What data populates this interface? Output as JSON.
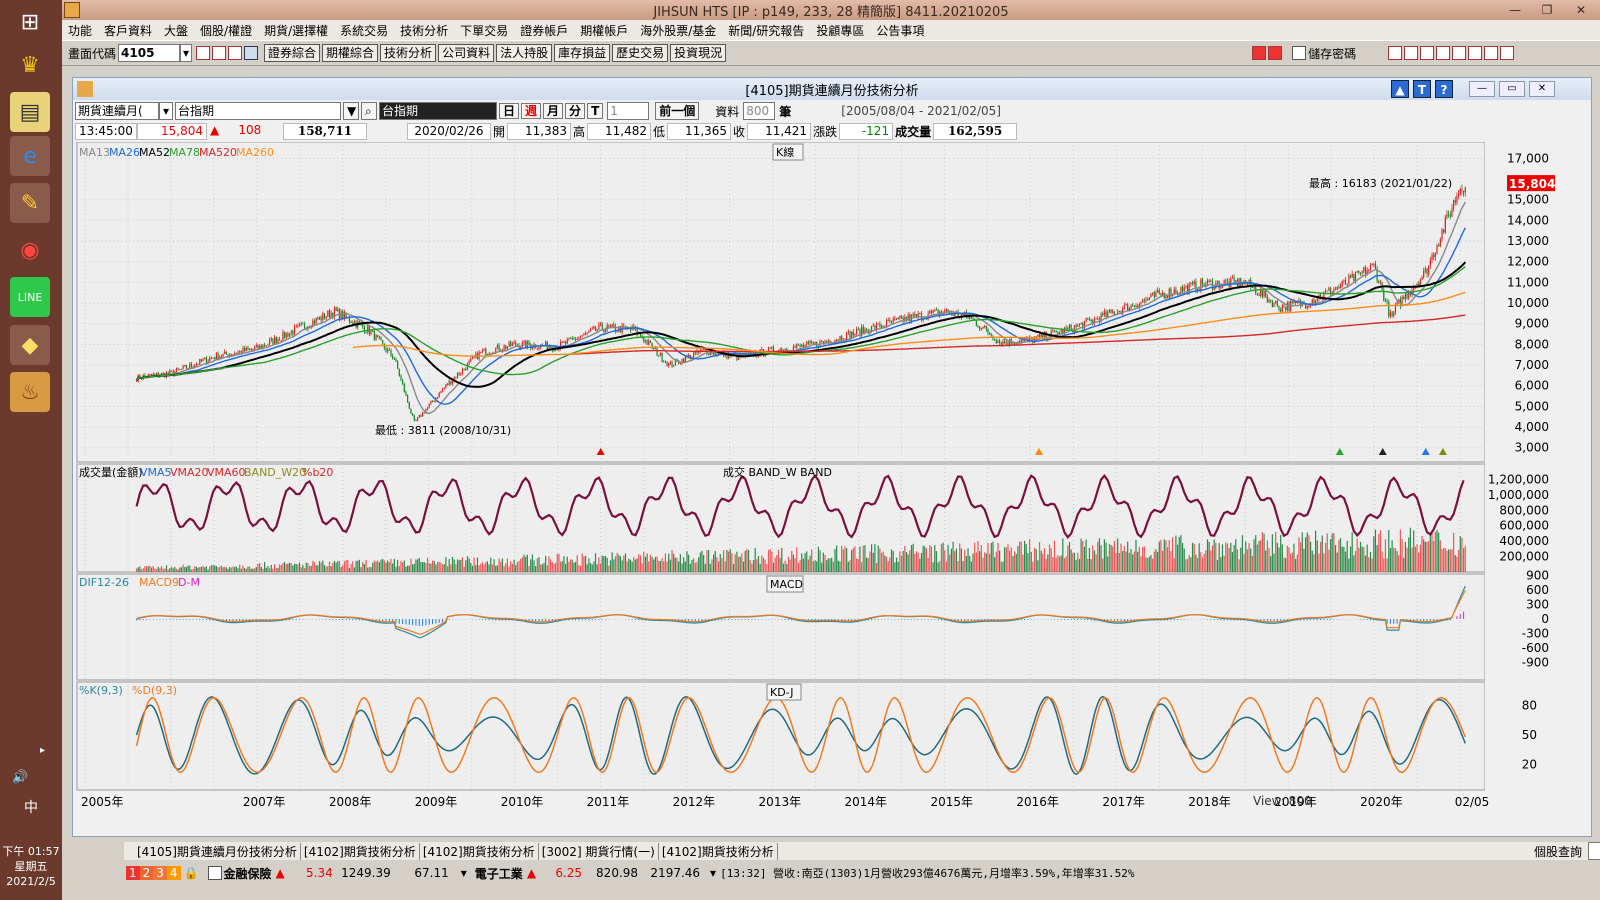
{
  "window_title": "JIHSUN HTS      [IP : p149, 233, 28 精簡版] 8411.20210205",
  "menu": [
    "功能",
    "客戶資料",
    "大盤",
    "個股/權證",
    "期貨/選擇權",
    "系統交易",
    "技術分析",
    "下單交易",
    "證券帳戶",
    "期權帳戶",
    "海外股票/基金",
    "新聞/研究報告",
    "投顧專區",
    "公告事項"
  ],
  "toolbar": {
    "code_label": "畫面代碼",
    "code_value": "4105",
    "buttons": [
      "證券綜合",
      "期權綜合",
      "技術分析",
      "公司資料",
      "法人持股",
      "庫存損益",
      "歷史交易",
      "投資現況"
    ],
    "save_password": "儲存密碼"
  },
  "inner": {
    "title": "[4105]期貨連續月份技術分析",
    "contract_select": "期貨連續月(",
    "symbol_input": "台指期",
    "symbol_name": "台指期",
    "periods": [
      "日",
      "週",
      "月",
      "分",
      "T"
    ],
    "period_qty": "1",
    "prev_btn": "前一個",
    "data_label": "資料",
    "data_count": "800",
    "data_unit": "筆",
    "date_range": "[2005/08/04 - 2021/02/05]"
  },
  "quote": {
    "time": "13:45:00",
    "price": "15,804",
    "change": "108",
    "volume_total": "158,711",
    "date": "2020/02/26",
    "open_label": "開",
    "open": "11,383",
    "high_label": "高",
    "high": "11,482",
    "low_label": "低",
    "low": "11,365",
    "close_label": "收",
    "close": "11,421",
    "chg_label": "漲跌",
    "chg": "-121",
    "vol_label": "成交量",
    "vol": "162,595"
  },
  "chart_data": [
    {
      "type": "line",
      "title": "K線",
      "legend": [
        "MA13",
        "MA26",
        "MA52",
        "MA78",
        "MA520",
        "MA260"
      ],
      "legend_colors": [
        "#888888",
        "#1e6ae0",
        "#000000",
        "#2ca02c",
        "#d62728",
        "#ff8c1a"
      ],
      "yticks": [
        17000,
        15000,
        14000,
        13000,
        12000,
        11000,
        10000,
        9000,
        8000,
        7000,
        6000,
        5000,
        4000,
        3000
      ],
      "ylim": [
        2600,
        17600
      ],
      "annotations": [
        "最高 : 16183 (2021/01/22)",
        "最低 : 3811 (2008/10/31)"
      ],
      "last_price": "15,804",
      "x": [
        2005.6,
        2006.0,
        2006.5,
        2007.0,
        2007.5,
        2007.9,
        2008.3,
        2008.6,
        2008.83,
        2009.2,
        2009.6,
        2010.0,
        2010.5,
        2011.0,
        2011.4,
        2011.8,
        2012.2,
        2012.6,
        2013.0,
        2013.5,
        2014.0,
        2014.5,
        2015.0,
        2015.3,
        2015.65,
        2016.0,
        2016.5,
        2017.0,
        2017.5,
        2018.0,
        2018.5,
        2018.9,
        2019.2,
        2019.6,
        2020.0,
        2020.2,
        2020.25,
        2020.6,
        2021.0,
        2021.06
      ],
      "close": [
        6400,
        6600,
        7400,
        7800,
        8800,
        9600,
        8700,
        7300,
        4200,
        6000,
        7600,
        8000,
        7900,
        8800,
        8700,
        7000,
        7700,
        7400,
        7700,
        8000,
        8600,
        9200,
        9600,
        9300,
        8100,
        8200,
        8800,
        9600,
        10400,
        10900,
        11000,
        9800,
        10000,
        10800,
        11800,
        9200,
        9800,
        11500,
        15600,
        15804
      ]
    },
    {
      "type": "bar",
      "title": "成交  BAND_W  BAND",
      "legend": [
        "成交量(金額)",
        "VMA5",
        "VMA20",
        "VMA60",
        "BAND_W20",
        "%b20"
      ],
      "yticks": [
        1200000,
        1000000,
        800000,
        600000,
        400000,
        200000
      ]
    },
    {
      "type": "line",
      "title": "MACD",
      "legend": [
        "DIF12-26",
        "MACD9",
        "D-M"
      ],
      "yticks": [
        900,
        600,
        300,
        0,
        -300,
        -600,
        -900
      ]
    },
    {
      "type": "line",
      "title": "KD-J",
      "legend": [
        "%K(9,3)",
        "%D(9,3)"
      ],
      "yticks": [
        80,
        50,
        20
      ]
    }
  ],
  "xaxis": [
    "2005年",
    "2007年",
    "2008年",
    "2009年",
    "2010年",
    "2011年",
    "2012年",
    "2013年",
    "2014年",
    "2015年",
    "2016年",
    "2017年",
    "2018年",
    "2019年",
    "2020年",
    "02/05"
  ],
  "scroll_view": "View: 800",
  "tabs": [
    "[4105]期貨連續月份技術分析",
    "[4102]期貨技術分析",
    "[4102]期貨技術分析",
    "[3002] 期貨行情(一)",
    "[4102]期貨技術分析"
  ],
  "right_query": "個股查詢",
  "ticker": {
    "sector1": "金融保險",
    "v1a": "5.34",
    "v1b": "1249.39",
    "v1c": "67.11",
    "sector2": "電子工業",
    "v2a": "6.25",
    "v2b": "820.98",
    "v2c": "2197.46",
    "news": "[13:32] 營收:南亞(1303)1月營收293億4676萬元,月增率3.59%,年增率31.52%"
  },
  "clock": {
    "time": "下午 01:57",
    "weekday": "星期五",
    "date": "2021/2/5",
    "ime": "中"
  }
}
